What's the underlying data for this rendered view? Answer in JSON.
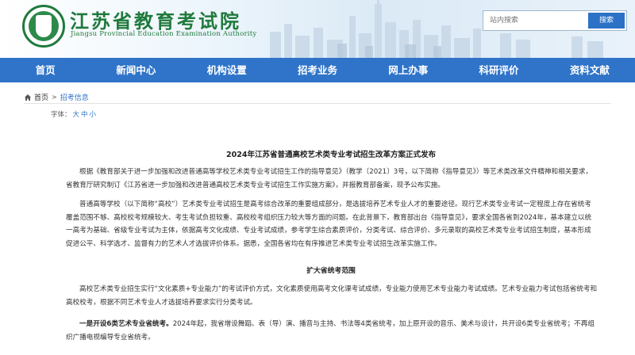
{
  "header": {
    "title": "江苏省教育考试院",
    "subtitle": "Jiangsu Provincial Education Examination Authority",
    "search_placeholder": "站内搜索",
    "search_button": "搜索"
  },
  "nav": {
    "items": [
      "首页",
      "新闻中心",
      "机构设置",
      "招考业务",
      "网上办事",
      "科研评价",
      "资料文献"
    ]
  },
  "breadcrumb": {
    "home": "首页",
    "separator": ">",
    "current": "招考信息"
  },
  "article": {
    "font_label": "字体：",
    "font_sizes": [
      "大",
      "中",
      "小"
    ],
    "title": "2024年江苏省普通高校艺术类专业考试招生改革方案正式发布",
    "paragraphs": [
      "根据《教育部关于进一步加强和改进普通高等学校艺术类专业考试招生工作的指导意见》（教学〔2021〕3号，以下简称《指导意见》）等艺术类改革文件精神和相关要求，省教育厅研究制订《江苏省进一步加强和改进普通高校艺术类专业考试招生工作实施方案》，并报教育部备案，现予公布实施。",
      "普通高等学校（以下简称“高校”）艺术类专业考试招生是高考综合改革的重要组成部分，是选拔培养艺术专业人才的重要途径。现行艺术类专业考试一定程度上存在省统考覆盖范围不够、高校校考规模较大、考生考试负担较重、高校校考组织压力较大等方面的问题。在此背景下，教育部出台《指导意见》，要求全国各省到2024年，基本建立以统一高考为基础、省级专业考试为主体，依据高考文化成绩、专业考试成绩，参考学生综合素质评价，分类考试、综合评价、多元录取的高校艺术类专业考试招生制度，基本形成促进公平、科学选才、监督有力的艺术人才选拔评价体系。据悉，全国各省均在有序推进艺术类专业考试招生改革实施工作。"
    ],
    "subheading": "扩大省统考范围",
    "paragraph3": "高校艺术类专业招生实行“文化素质+专业能力”的考试评价方式，文化素质使用高考文化课考试成绩，专业能力使用艺术专业能力考试成绩。艺术专业能力考试包括省统考和高校校考，根据不同艺术专业人才选拔培养要求实行分类考试。",
    "paragraph4_bold": "一是开设6类艺术专业省统考。",
    "paragraph4_rest": "2024年起，我省增设舞蹈、表（导）演、播音与主持、书法等4类省统考，加上原开设的音乐、美术与设计，共开设6类专业省统考；不再组织广播电视编导专业省统考。"
  },
  "colors": {
    "brand_green": "#1f7a3c",
    "nav_blue": "#2f74c8",
    "link_blue": "#2f74c8"
  }
}
